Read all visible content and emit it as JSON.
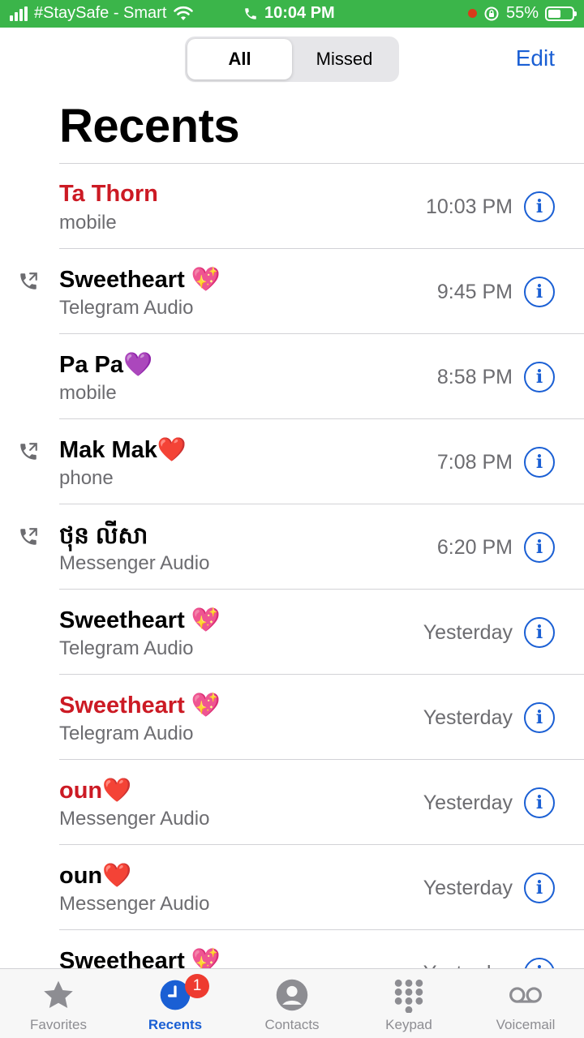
{
  "status_bar": {
    "carrier": "#StaySafe - Smart",
    "time": "10:04 PM",
    "battery": "55%",
    "battery_level": 0.55
  },
  "header": {
    "tabs": [
      "All",
      "Missed"
    ],
    "active_tab": "All",
    "edit_label": "Edit",
    "title": "Recents"
  },
  "calls": [
    {
      "name": "Ta Thorn",
      "type": "mobile",
      "time": "10:03 PM",
      "missed": true,
      "outgoing": false
    },
    {
      "name": "Sweetheart 💖",
      "type": "Telegram Audio",
      "time": "9:45 PM",
      "missed": false,
      "outgoing": true
    },
    {
      "name": "Pa Pa💜",
      "type": "mobile",
      "time": "8:58 PM",
      "missed": false,
      "outgoing": false
    },
    {
      "name": "Mak Mak❤️",
      "type": "phone",
      "time": "7:08 PM",
      "missed": false,
      "outgoing": true
    },
    {
      "name": "ថុន លីសា",
      "type": "Messenger Audio",
      "time": "6:20 PM",
      "missed": false,
      "outgoing": true
    },
    {
      "name": "Sweetheart 💖",
      "type": "Telegram Audio",
      "time": "Yesterday",
      "missed": false,
      "outgoing": false
    },
    {
      "name": "Sweetheart 💖",
      "type": "Telegram Audio",
      "time": "Yesterday",
      "missed": true,
      "outgoing": false
    },
    {
      "name": "oun❤️",
      "type": "Messenger Audio",
      "time": "Yesterday",
      "missed": true,
      "outgoing": false
    },
    {
      "name": "oun❤️",
      "type": "Messenger Audio",
      "time": "Yesterday",
      "missed": false,
      "outgoing": false
    },
    {
      "name": "Sweetheart 💖",
      "type": "",
      "time": "Yesterday",
      "missed": false,
      "outgoing": false
    }
  ],
  "tab_bar": {
    "items": [
      {
        "label": "Favorites",
        "icon": "star-icon"
      },
      {
        "label": "Recents",
        "icon": "clock-icon",
        "badge": "1"
      },
      {
        "label": "Contacts",
        "icon": "person-icon"
      },
      {
        "label": "Keypad",
        "icon": "keypad-icon"
      },
      {
        "label": "Voicemail",
        "icon": "voicemail-icon"
      }
    ],
    "active": "Recents"
  },
  "colors": {
    "accent": "#1a5fd4",
    "missed": "#cc1a24",
    "status_bar": "#3bb54a",
    "badge": "#ee3b30"
  }
}
